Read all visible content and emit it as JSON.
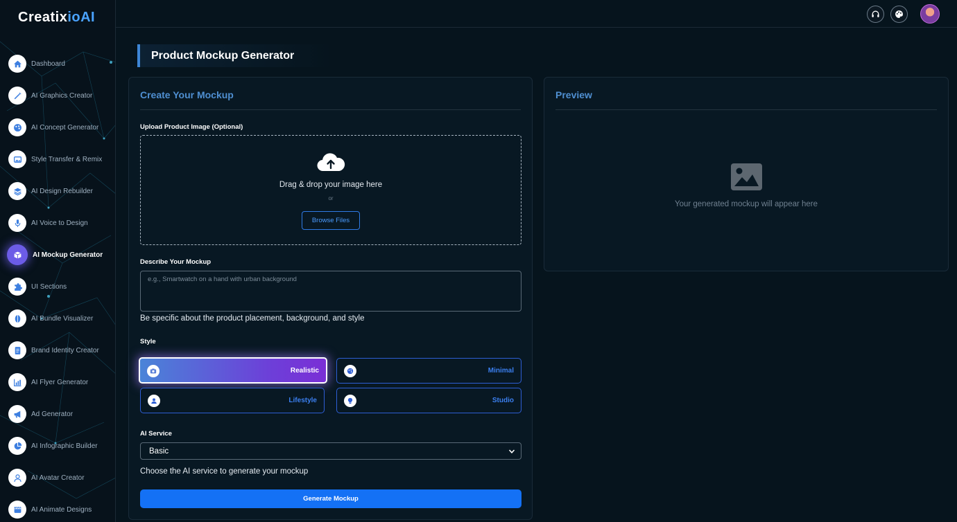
{
  "app": {
    "logo_main": "Creatix",
    "logo_accent": "ioAI"
  },
  "sidebar": {
    "items": [
      {
        "label": "Dashboard",
        "icon": "home-icon"
      },
      {
        "label": "AI Graphics Creator",
        "icon": "magic-wand-icon"
      },
      {
        "label": "AI Concept Generator",
        "icon": "palette-icon"
      },
      {
        "label": "Style Transfer & Remix",
        "icon": "image-icon"
      },
      {
        "label": "AI Design Rebuilder",
        "icon": "layers-icon"
      },
      {
        "label": "AI Voice to Design",
        "icon": "microphone-icon"
      },
      {
        "label": "AI Mockup Generator",
        "icon": "box-icon",
        "active": true
      },
      {
        "label": "UI Sections",
        "icon": "puzzle-icon"
      },
      {
        "label": "AI Bundle Visualizer",
        "icon": "bundle-icon"
      },
      {
        "label": "Brand Identity Creator",
        "icon": "document-icon"
      },
      {
        "label": "AI Flyer Generator",
        "icon": "chart-icon"
      },
      {
        "label": "Ad Generator",
        "icon": "megaphone-icon"
      },
      {
        "label": "AI Infographic Builder",
        "icon": "pie-chart-icon"
      },
      {
        "label": "AI Avatar Creator",
        "icon": "user-icon"
      },
      {
        "label": "AI Animate Designs",
        "icon": "film-icon"
      }
    ]
  },
  "topbar": {
    "icons": [
      "headset-icon",
      "palette-icon"
    ]
  },
  "page": {
    "title": "Product Mockup Generator"
  },
  "form": {
    "heading": "Create Your Mockup",
    "upload_label": "Upload Product Image (Optional)",
    "drop_text": "Drag & drop your image here",
    "drop_or": "or",
    "browse_label": "Browse Files",
    "describe_label": "Describe Your Mockup",
    "describe_placeholder": "e.g., Smartwatch on a hand with urban background",
    "describe_value": "",
    "describe_help": "Be specific about the product placement, background, and style",
    "style_label": "Style",
    "styles": [
      {
        "label": "Realistic",
        "icon": "camera-icon",
        "selected": true
      },
      {
        "label": "Minimal",
        "icon": "palette-icon",
        "selected": false
      },
      {
        "label": "Lifestyle",
        "icon": "user-icon",
        "selected": false
      },
      {
        "label": "Studio",
        "icon": "lightbulb-icon",
        "selected": false
      }
    ],
    "service_label": "AI Service",
    "service_value": "Basic",
    "service_help": "Choose the AI service to generate your mockup",
    "generate_label": "Generate Mockup"
  },
  "preview": {
    "heading": "Preview",
    "placeholder_text": "Your generated mockup will appear here"
  },
  "colors": {
    "accent": "#1471f5",
    "heading": "#4f8fd1",
    "active_nav": "#6c5ce7"
  }
}
